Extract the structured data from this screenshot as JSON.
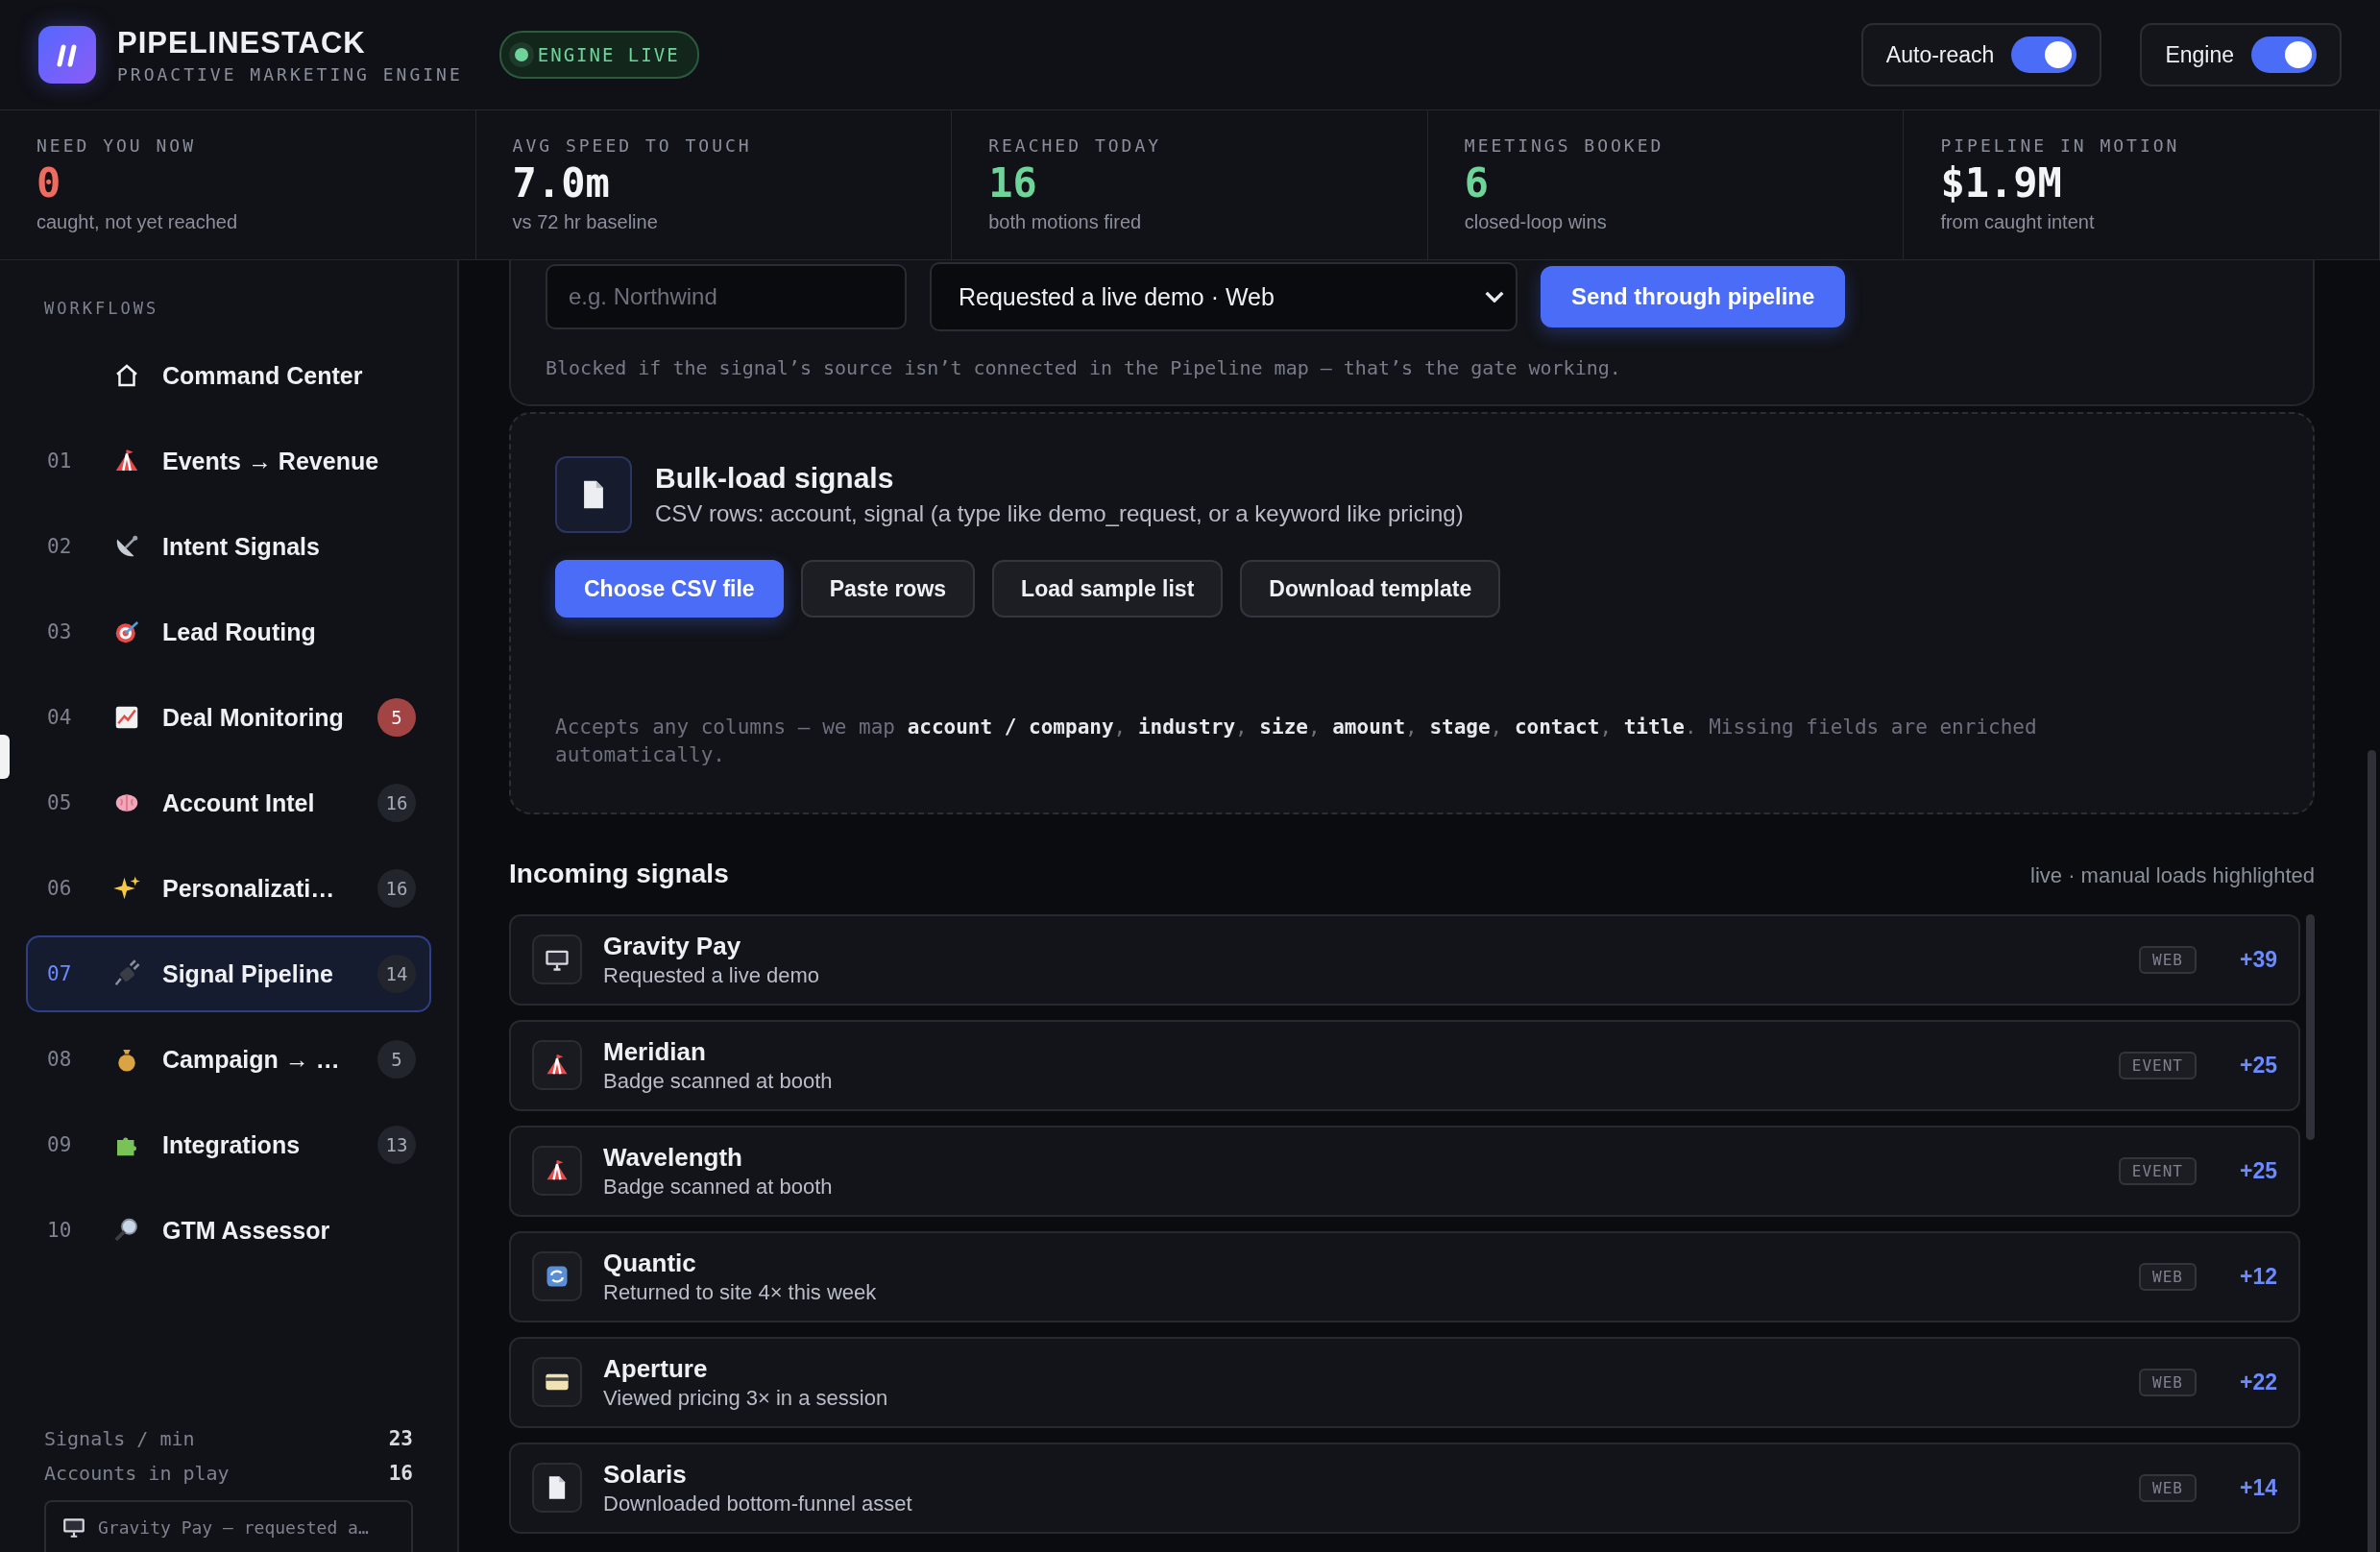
{
  "header": {
    "brand": "PIPELINESTACK",
    "tagline": "PROACTIVE MARKETING ENGINE",
    "status": "ENGINE LIVE",
    "toggles": [
      {
        "label": "Auto-reach",
        "on": true
      },
      {
        "label": "Engine",
        "on": true
      }
    ]
  },
  "stats": [
    {
      "label": "NEED YOU NOW",
      "value": "0",
      "note": "caught, not yet reached",
      "color": "#ee6b5f"
    },
    {
      "label": "AVG SPEED TO TOUCH",
      "value": "7.0m",
      "note": "vs 72 hr baseline",
      "color": "#f3f4f6"
    },
    {
      "label": "REACHED TODAY",
      "value": "16",
      "note": "both motions fired",
      "color": "#6fd49a"
    },
    {
      "label": "MEETINGS BOOKED",
      "value": "6",
      "note": "closed-loop wins",
      "color": "#6fd49a"
    },
    {
      "label": "PIPELINE IN MOTION",
      "value": "$1.9M",
      "note": "from caught intent",
      "color": "#f3f4f6"
    }
  ],
  "sidebar": {
    "heading": "WORKFLOWS",
    "items": [
      {
        "label": "Command Center",
        "selected": false
      },
      {
        "number": "01",
        "label": "Events → Revenue",
        "selected": false
      },
      {
        "number": "02",
        "label": "Intent Signals",
        "selected": false
      },
      {
        "number": "03",
        "label": "Lead Routing",
        "selected": false
      },
      {
        "number": "04",
        "label": "Deal Monitoring",
        "count": "5",
        "selected": false,
        "alert": true
      },
      {
        "number": "05",
        "label": "Account Intel",
        "count": "16",
        "selected": false,
        "alert": false
      },
      {
        "number": "06",
        "label": "Personalizati…",
        "count": "16",
        "selected": false,
        "alert": false
      },
      {
        "number": "07",
        "label": "Signal Pipeline",
        "count": "14",
        "selected": true,
        "alert": false
      },
      {
        "number": "08",
        "label": "Campaign → …",
        "count": "5",
        "selected": false,
        "alert": false
      },
      {
        "number": "09",
        "label": "Integrations",
        "count": "13",
        "selected": false,
        "alert": false
      },
      {
        "number": "10",
        "label": "GTM Assessor",
        "selected": false
      }
    ],
    "footer": [
      {
        "label": "Signals / min",
        "value": "23"
      },
      {
        "label": "Accounts in play",
        "value": "16"
      }
    ],
    "ticker": "Gravity Pay — requested a…"
  },
  "form": {
    "account_placeholder": "e.g. Northwind",
    "signal": "Requested a live demo · Web",
    "submit": "Send through pipeline",
    "hint": "Blocked if the signal’s source isn’t connected in the Pipeline map — that’s the gate working."
  },
  "bulk": {
    "title": "Bulk-load signals",
    "subtitle": "CSV rows: account, signal (a type like demo_request, or a keyword like pricing)",
    "buttons": [
      {
        "label": "Choose CSV file",
        "primary": true
      },
      {
        "label": "Paste rows",
        "primary": false
      },
      {
        "label": "Load sample list",
        "primary": false
      },
      {
        "label": "Download template",
        "primary": false
      }
    ],
    "note": "Accepts any columns — we map **account / company**, **industry**, **size**, **amount**, **stage**, **contact**, **title**. Missing fields are enriched automatically."
  },
  "incoming": {
    "title": "Incoming signals",
    "caption": "live · manual loads highlighted",
    "rows": [
      {
        "account": "Gravity Pay",
        "signal": "Requested a live demo",
        "source": "WEB",
        "score": "+39"
      },
      {
        "account": "Meridian",
        "signal": "Badge scanned at booth",
        "source": "EVENT",
        "score": "+25"
      },
      {
        "account": "Wavelength",
        "signal": "Badge scanned at booth",
        "source": "EVENT",
        "score": "+25"
      },
      {
        "account": "Quantic",
        "signal": "Returned to site 4× this week",
        "source": "WEB",
        "score": "+12"
      },
      {
        "account": "Aperture",
        "signal": "Viewed pricing 3× in a session",
        "source": "WEB",
        "score": "+22"
      },
      {
        "account": "Solaris",
        "signal": "Downloaded bottom-funnel asset",
        "source": "WEB",
        "score": "+14"
      }
    ]
  }
}
